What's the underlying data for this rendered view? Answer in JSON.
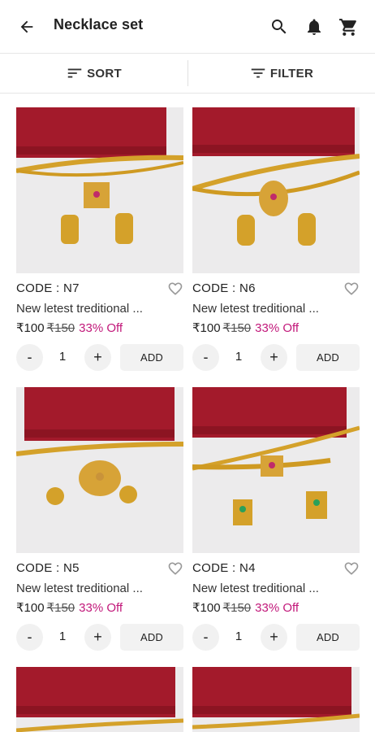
{
  "header": {
    "title": "Necklace set"
  },
  "icons": {
    "back": "arrow-left-icon",
    "search": "search-icon",
    "notifications": "bell-icon",
    "cart": "cart-icon",
    "sort": "sort-icon",
    "filter": "filter-icon",
    "wishlist": "heart-outline-icon"
  },
  "toolbar": {
    "sort_label": "SORT",
    "filter_label": "FILTER"
  },
  "colors": {
    "discount": "#c2187a",
    "box_red": "#a8182a",
    "gold": "#d4a12a"
  },
  "products": [
    {
      "code": "CODE : N7",
      "name": "New letest treditional ...",
      "price": "₹100",
      "mrp": "₹150",
      "discount": "33% Off",
      "qty": "1",
      "minus": "-",
      "plus": "+",
      "add": "ADD"
    },
    {
      "code": "CODE : N6",
      "name": "New letest treditional ...",
      "price": "₹100",
      "mrp": "₹150",
      "discount": "33% Off",
      "qty": "1",
      "minus": "-",
      "plus": "+",
      "add": "ADD"
    },
    {
      "code": "CODE : N5",
      "name": "New letest treditional ...",
      "price": "₹100",
      "mrp": "₹150",
      "discount": "33% Off",
      "qty": "1",
      "minus": "-",
      "plus": "+",
      "add": "ADD"
    },
    {
      "code": "CODE : N4",
      "name": "New letest treditional ...",
      "price": "₹100",
      "mrp": "₹150",
      "discount": "33% Off",
      "qty": "1",
      "minus": "-",
      "plus": "+",
      "add": "ADD"
    }
  ]
}
